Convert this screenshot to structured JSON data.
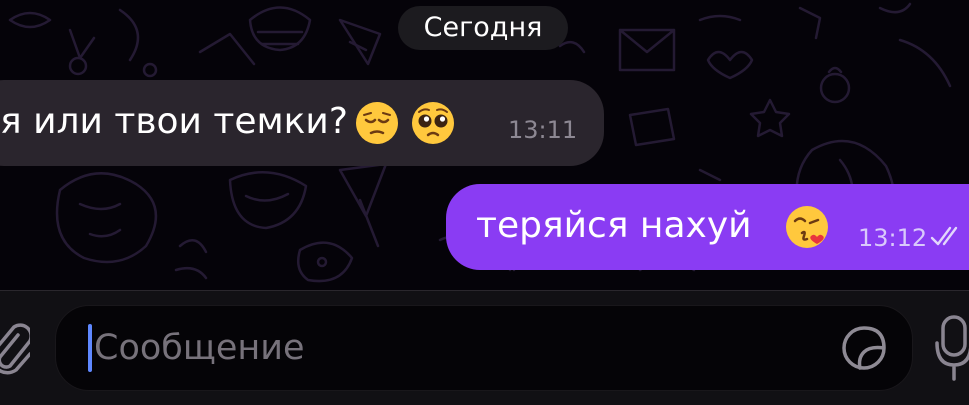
{
  "chat": {
    "date_separator": "Сегодня",
    "messages": [
      {
        "direction": "incoming",
        "text": "я или твои темки?",
        "emoji": [
          "pensive-face",
          "pleading-face"
        ],
        "time": "13:11"
      },
      {
        "direction": "outgoing",
        "text": "теряйся нахуй",
        "emoji": [
          "face-blowing-a-kiss"
        ],
        "time": "13:12",
        "status": "read"
      }
    ]
  },
  "composer": {
    "placeholder": "Сообщение",
    "icons": [
      "paperclip-icon",
      "sticker-icon",
      "microphone-icon"
    ]
  },
  "colors": {
    "background": "#050309",
    "incoming_bubble": "#2a252d",
    "outgoing_bubble": "#8a3cf3",
    "caret": "#5f88ff"
  }
}
